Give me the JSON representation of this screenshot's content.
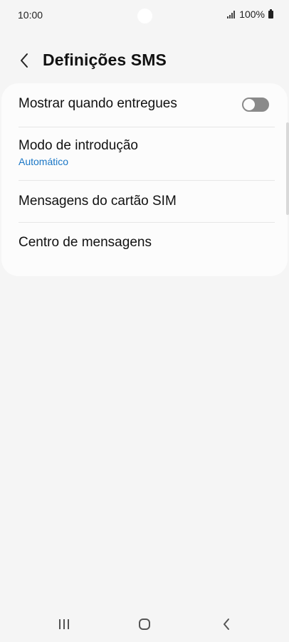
{
  "status_bar": {
    "time": "10:00",
    "battery": "100%",
    "icons": [
      "signal-icon",
      "battery-icon"
    ]
  },
  "header": {
    "title": "Definições SMS",
    "back_icon": "chevron-left-icon"
  },
  "settings": {
    "items": [
      {
        "label": "Mostrar quando entregues",
        "toggle": "off"
      },
      {
        "label": "Modo de introdução",
        "value": "Automático"
      },
      {
        "label": "Mensagens do cartão SIM"
      },
      {
        "label": "Centro de mensagens"
      }
    ]
  },
  "nav": {
    "icons": [
      "recent-apps-icon",
      "home-icon",
      "back-icon"
    ]
  },
  "colors": {
    "background": "#f5f5f5",
    "card": "#fcfcfc",
    "accent": "#1b77c6",
    "toggle_off": "#8a8a8a"
  }
}
